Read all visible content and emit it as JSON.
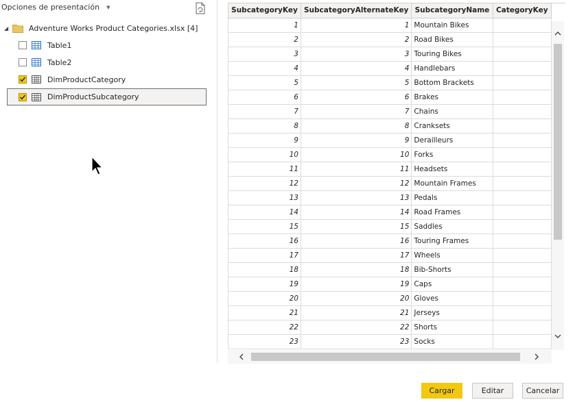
{
  "navigator": {
    "display_options_label": "Opciones de presentación",
    "root_label": "Adventure Works Product Categories.xlsx [4]",
    "items": [
      {
        "label": "Table1",
        "checked": false,
        "icon": "table-icon"
      },
      {
        "label": "Table2",
        "checked": false,
        "icon": "table-icon"
      },
      {
        "label": "DimProductCategory",
        "checked": true,
        "icon": "sheet-icon"
      },
      {
        "label": "DimProductSubcategory",
        "checked": true,
        "icon": "sheet-icon",
        "selected": true
      }
    ]
  },
  "preview": {
    "columns": [
      "SubcategoryKey",
      "SubcategoryAlternateKey",
      "SubcategoryName",
      "CategoryKey"
    ],
    "rows": [
      [
        "1",
        "1",
        "Mountain Bikes",
        ""
      ],
      [
        "2",
        "2",
        "Road Bikes",
        ""
      ],
      [
        "3",
        "3",
        "Touring Bikes",
        ""
      ],
      [
        "4",
        "4",
        "Handlebars",
        ""
      ],
      [
        "5",
        "5",
        "Bottom Brackets",
        ""
      ],
      [
        "6",
        "6",
        "Brakes",
        ""
      ],
      [
        "7",
        "7",
        "Chains",
        ""
      ],
      [
        "8",
        "8",
        "Cranksets",
        ""
      ],
      [
        "9",
        "9",
        "Derailleurs",
        ""
      ],
      [
        "10",
        "10",
        "Forks",
        ""
      ],
      [
        "11",
        "11",
        "Headsets",
        ""
      ],
      [
        "12",
        "12",
        "Mountain Frames",
        ""
      ],
      [
        "13",
        "13",
        "Pedals",
        ""
      ],
      [
        "14",
        "14",
        "Road Frames",
        ""
      ],
      [
        "15",
        "15",
        "Saddles",
        ""
      ],
      [
        "16",
        "16",
        "Touring Frames",
        ""
      ],
      [
        "17",
        "17",
        "Wheels",
        ""
      ],
      [
        "18",
        "18",
        "Bib-Shorts",
        ""
      ],
      [
        "19",
        "19",
        "Caps",
        ""
      ],
      [
        "20",
        "20",
        "Gloves",
        ""
      ],
      [
        "21",
        "21",
        "Jerseys",
        ""
      ],
      [
        "22",
        "22",
        "Shorts",
        ""
      ],
      [
        "23",
        "23",
        "Socks",
        ""
      ]
    ]
  },
  "buttons": {
    "load": "Cargar",
    "edit": "Editar",
    "cancel": "Cancelar"
  },
  "colors": {
    "accent": "#f2c811",
    "selection_bg": "#f3f2f1"
  }
}
